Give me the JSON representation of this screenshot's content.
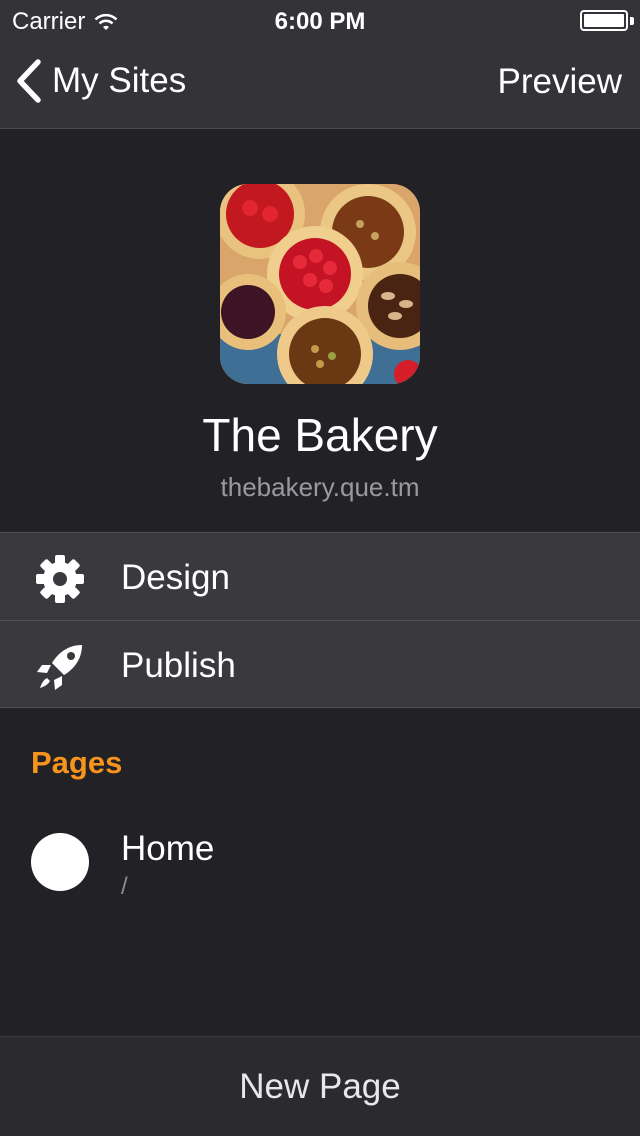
{
  "status": {
    "carrier": "Carrier",
    "time": "6:00 PM"
  },
  "nav": {
    "back_label": "My Sites",
    "preview_label": "Preview"
  },
  "site": {
    "title": "The Bakery",
    "url": "thebakery.que.tm"
  },
  "menu": {
    "items": [
      {
        "label": "Design",
        "icon": "gear-icon"
      },
      {
        "label": "Publish",
        "icon": "rocket-icon"
      }
    ]
  },
  "pages": {
    "section_title": "Pages",
    "items": [
      {
        "name": "Home",
        "path": "/"
      }
    ]
  },
  "bottom": {
    "new_page_label": "New Page"
  },
  "colors": {
    "accent": "#f7941d",
    "background": "#222126",
    "row_background": "#39393e",
    "topbar": "#333338"
  }
}
